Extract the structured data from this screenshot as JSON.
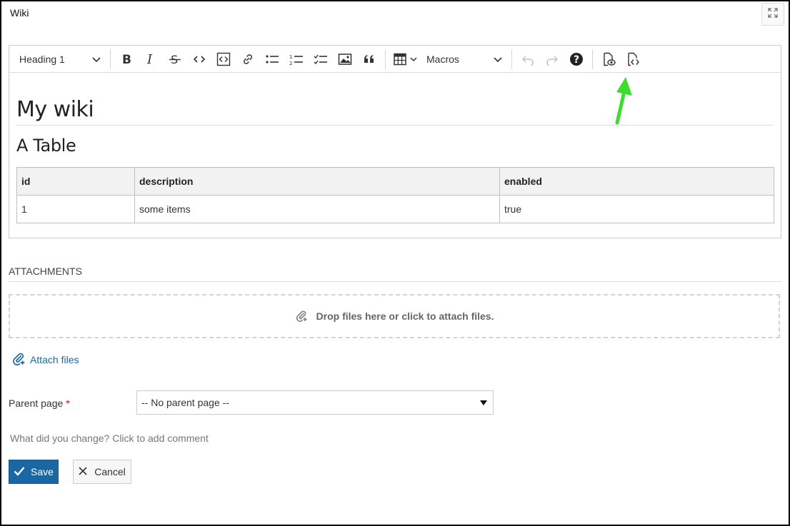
{
  "page": {
    "title": "Wiki"
  },
  "header": {
    "fullscreen_icon": "fullscreen-icon"
  },
  "toolbar": {
    "heading_select": "Heading 1",
    "macros_select": "Macros",
    "buttons": [
      "bold-icon",
      "italic-icon",
      "strikethrough-icon",
      "inline-code-icon",
      "code-block-icon",
      "link-icon",
      "bulleted-list-icon",
      "numbered-list-icon",
      "todo-list-icon",
      "image-icon",
      "blockquote-icon",
      "table-icon",
      "undo-icon",
      "redo-icon",
      "help-icon",
      "preview-icon",
      "source-mode-icon"
    ]
  },
  "editor": {
    "h1": "My wiki",
    "h2": "A Table",
    "table": {
      "headers": [
        "id",
        "description",
        "enabled"
      ],
      "rows": [
        [
          "1",
          "some items",
          "true"
        ]
      ]
    }
  },
  "annotation": {
    "color": "#3ddc2f"
  },
  "attachments": {
    "heading": "ATTACHMENTS",
    "dropzone_text": "Drop files here or click to attach files.",
    "attach_link": "Attach files"
  },
  "form": {
    "parent_label": "Parent page",
    "required_marker": "*",
    "parent_select_value": "-- No parent page --",
    "comment_prompt": "What did you change? Click to add comment",
    "save_label": "Save",
    "cancel_label": "Cancel"
  },
  "colors": {
    "primary": "#1a67a3",
    "link": "#1a67a3"
  }
}
